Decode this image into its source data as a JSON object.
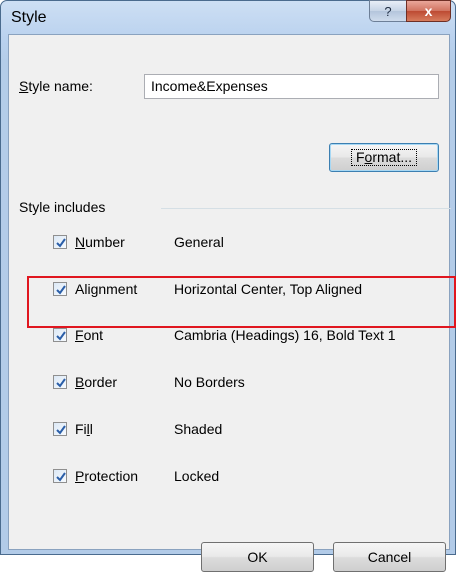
{
  "window": {
    "title": "Style",
    "help_label": "?",
    "close_label": "x"
  },
  "style_name": {
    "label_mnemonic": "S",
    "label_rest": "tyle name:",
    "value": "Income&Expenses"
  },
  "format_button": {
    "pre": "F",
    "mnemonic": "o",
    "rest": "rmat..."
  },
  "group": {
    "label": "Style includes"
  },
  "items": [
    {
      "mnemonic": "N",
      "rest": "umber",
      "value": "General",
      "checked": true
    },
    {
      "pre": "Ali",
      "mnemonic": "g",
      "rest": "nment",
      "value": "Horizontal Center, Top Aligned",
      "checked": true
    },
    {
      "mnemonic": "F",
      "rest": "ont",
      "value": "Cambria (Headings) 16, Bold Text 1",
      "checked": true,
      "highlighted": true
    },
    {
      "mnemonic": "B",
      "rest": "order",
      "value": "No Borders",
      "checked": true
    },
    {
      "pre": "Fi",
      "mnemonic": "l",
      "rest": "l",
      "value": "Shaded",
      "checked": true
    },
    {
      "mnemonic": "P",
      "rest": "rotection",
      "value": "Locked",
      "checked": true
    }
  ],
  "buttons": {
    "ok": "OK",
    "cancel": "Cancel"
  },
  "colors": {
    "highlight_border": "#e0161f",
    "checkmark": "#2a5ea8"
  }
}
